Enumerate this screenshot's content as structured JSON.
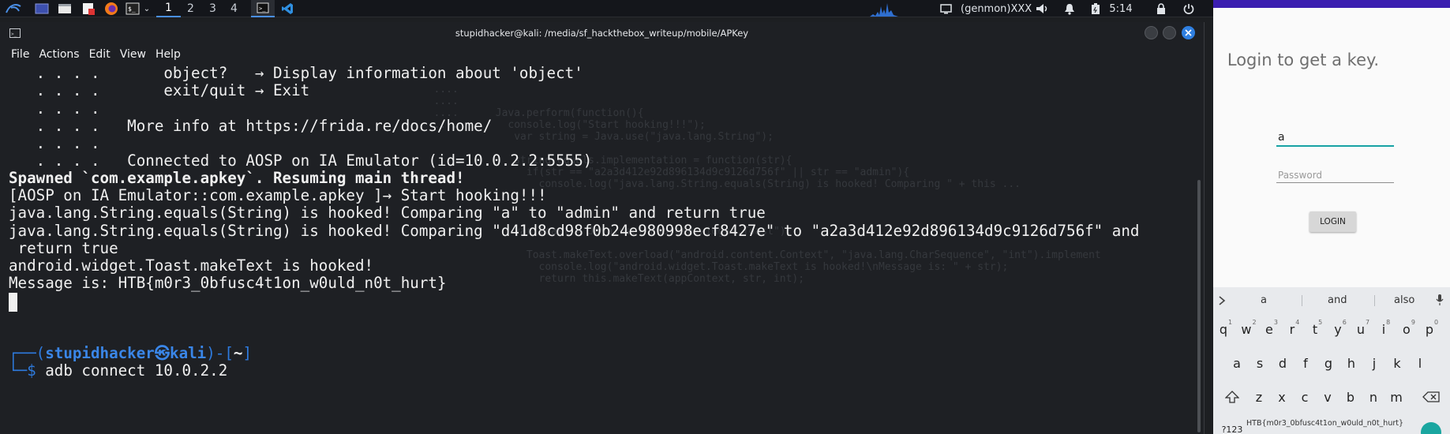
{
  "taskbar": {
    "workspaces": [
      "1",
      "2",
      "3",
      "4"
    ],
    "status_text": "(genmon)XXX",
    "clock": "5:14",
    "icons": [
      "kali-menu-icon",
      "desktop-icon",
      "file-manager-icon",
      "text-editor-icon",
      "firefox-icon",
      "terminal-icon",
      "chevron-down-icon",
      "terminal-window-icon",
      "vscode-icon",
      "network-graph-icon",
      "display-icon",
      "volume-icon",
      "bell-icon",
      "battery-icon",
      "lock-icon",
      "power-icon"
    ]
  },
  "terminal": {
    "title": "stupidhacker@kali: /media/sf_hackthebox_writeup/mobile/APKey",
    "menu": [
      "File",
      "Actions",
      "Edit",
      "View",
      "Help"
    ],
    "lines": [
      "   . . . .       object?   → Display information about 'object'",
      "   . . . .       exit/quit → Exit",
      "   . . . .",
      "   . . . .   More info at https://frida.re/docs/home/",
      "   . . . .",
      "   . . . .   Connected to AOSP on IA Emulator (id=10.0.2.2:5555)",
      "Spawned `com.example.apkey`. Resuming main thread!",
      "[AOSP on IA Emulator::com.example.apkey ]→ Start hooking!!!",
      "java.lang.String.equals(String) is hooked! Comparing \"a\" to \"admin\" and return true",
      "java.lang.String.equals(String) is hooked! Comparing \"d41d8cd98f0b24e980998ecf8427e\" to \"a2a3d412e92d896134d9c9126d756f\" and",
      " return true",
      "android.widget.Toast.makeText is hooked!",
      "Message is: HTB{m0r3_0bfusc4t1on_w0uld_n0t_hurt}"
    ],
    "prompt": {
      "open": "┌──(",
      "user": "stupidhacker",
      "at": "㉿",
      "host": "kali",
      "mid": ")-[",
      "dir": "~",
      "close": "]",
      "cmd_prefix": "└─$ ",
      "cmd": "adb connect 10.0.2.2"
    }
  },
  "android": {
    "title": "Login to get a key.",
    "username_value": "a",
    "password_placeholder": "Password",
    "login_label": "LOGIN",
    "suggestions": [
      "a",
      "and",
      "also"
    ],
    "keyboard_rows": [
      [
        "q",
        "w",
        "e",
        "r",
        "t",
        "y",
        "u",
        "i",
        "o",
        "p"
      ],
      [
        "a",
        "s",
        "d",
        "f",
        "g",
        "h",
        "j",
        "k",
        "l"
      ],
      [
        "z",
        "x",
        "c",
        "v",
        "b",
        "n",
        "m"
      ]
    ],
    "number_hints": [
      "1",
      "2",
      "3",
      "4",
      "5",
      "6",
      "7",
      "8",
      "9",
      "0"
    ],
    "symbols_key": "?123",
    "toast": "HTB{m0r3_0bfusc4t1on_w0uld_n0t_hurt}"
  },
  "colors": {
    "terminal_bg": "#1e2024",
    "prompt_blue": "#2e7bdf",
    "android_accent": "#3b1eb0",
    "field_underline": "#17a2a4"
  }
}
